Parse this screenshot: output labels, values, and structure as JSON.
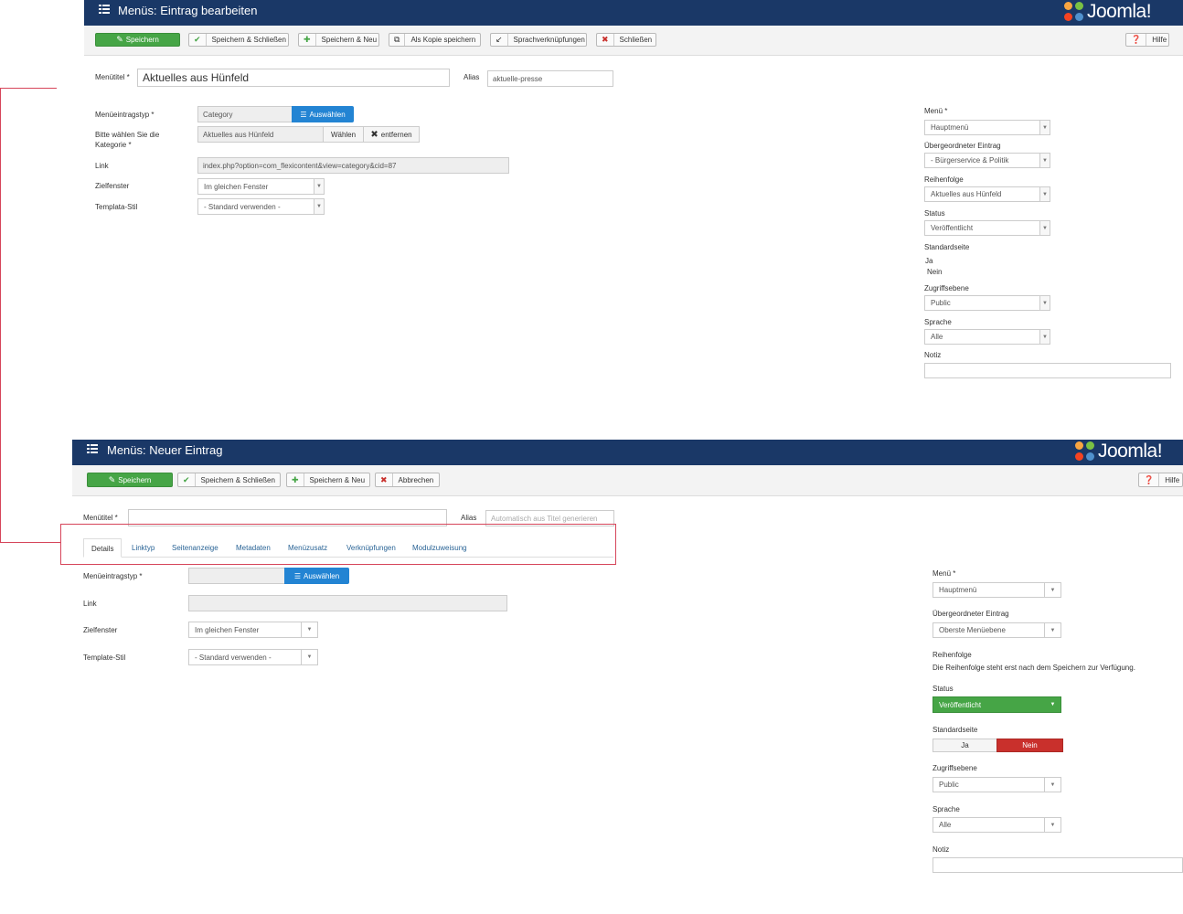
{
  "top": {
    "title": "Menüs: Eintrag bearbeiten",
    "brand": "Joomla!",
    "toolbar": {
      "save": "Speichern",
      "save_close": "Speichern & Schließen",
      "save_new": "Speichern & Neu",
      "save_copy": "Als Kopie speichern",
      "associations": "Sprachverknüpfungen",
      "close": "Schließen",
      "help": "Hilfe"
    },
    "form": {
      "title_label": "Menütitel *",
      "title_value": "Aktuelles aus Hünfeld",
      "alias_label": "Alias",
      "alias_value": "aktuelle-presse",
      "type_label": "Menüeintragstyp *",
      "type_value": "Category",
      "select_btn": "Auswählen",
      "category_label_1": "Bitte wählen Sie die",
      "category_label_2": "Kategorie *",
      "category_value": "Aktuelles aus Hünfeld",
      "choose_btn": "Wählen",
      "remove_btn": "entfernen",
      "link_label": "Link",
      "link_value": "index.php?option=com_flexicontent&view=category&cid=87",
      "target_label": "Zielfenster",
      "target_value": "Im gleichen Fenster",
      "template_label": "Templata-Stil",
      "template_value": "- Standard verwenden -"
    },
    "side": {
      "menu_label": "Menü *",
      "menu_value": "Hauptmenü",
      "parent_label": "Übergeordneter Eintrag",
      "parent_value": "- Bürgerservice & Politik",
      "order_label": "Reihenfolge",
      "order_value": "Aktuelles aus Hünfeld",
      "status_label": "Status",
      "status_value": "Veröffentlicht",
      "default_label": "Standardseite",
      "default_yes": "Ja",
      "default_no": "Nein",
      "access_label": "Zugriffsebene",
      "access_value": "Public",
      "lang_label": "Sprache",
      "lang_value": "Alle",
      "note_label": "Notiz"
    }
  },
  "bottom": {
    "title": "Menüs: Neuer Eintrag",
    "brand": "Joomla!",
    "toolbar": {
      "save": "Speichern",
      "save_close": "Speichern & Schließen",
      "save_new": "Speichern & Neu",
      "cancel": "Abbrechen",
      "help": "Hilfe"
    },
    "form": {
      "title_label": "Menütitel *",
      "alias_label": "Alias",
      "alias_placeholder": "Automatisch aus Titel generieren",
      "tabs": [
        "Details",
        "Linktyp",
        "Seitenanzeige",
        "Metadaten",
        "Menüzusatz",
        "Verknüpfungen",
        "Modulzuweisung"
      ],
      "type_label": "Menüeintragstyp *",
      "select_btn": "Auswählen",
      "link_label": "Link",
      "target_label": "Zielfenster",
      "target_value": "Im gleichen Fenster",
      "template_label": "Template-Stil",
      "template_value": "- Standard verwenden -"
    },
    "side": {
      "menu_label": "Menü *",
      "menu_value": "Hauptmenü",
      "parent_label": "Übergeordneter Eintrag",
      "parent_value": "Oberste Menüebene",
      "order_label": "Reihenfolge",
      "order_note": "Die Reihenfolge steht erst nach dem Speichern zur Verfügung.",
      "status_label": "Status",
      "status_value": "Veröffentlicht",
      "default_label": "Standardseite",
      "default_yes": "Ja",
      "default_no": "Nein",
      "access_label": "Zugriffsebene",
      "access_value": "Public",
      "lang_label": "Sprache",
      "lang_value": "Alle",
      "note_label": "Notiz"
    }
  },
  "colors": {
    "header": "#1a3867",
    "save_green": "#46a546",
    "select_blue": "#2384d3",
    "no_red": "#c9302c",
    "highlight": "#d6455a"
  }
}
